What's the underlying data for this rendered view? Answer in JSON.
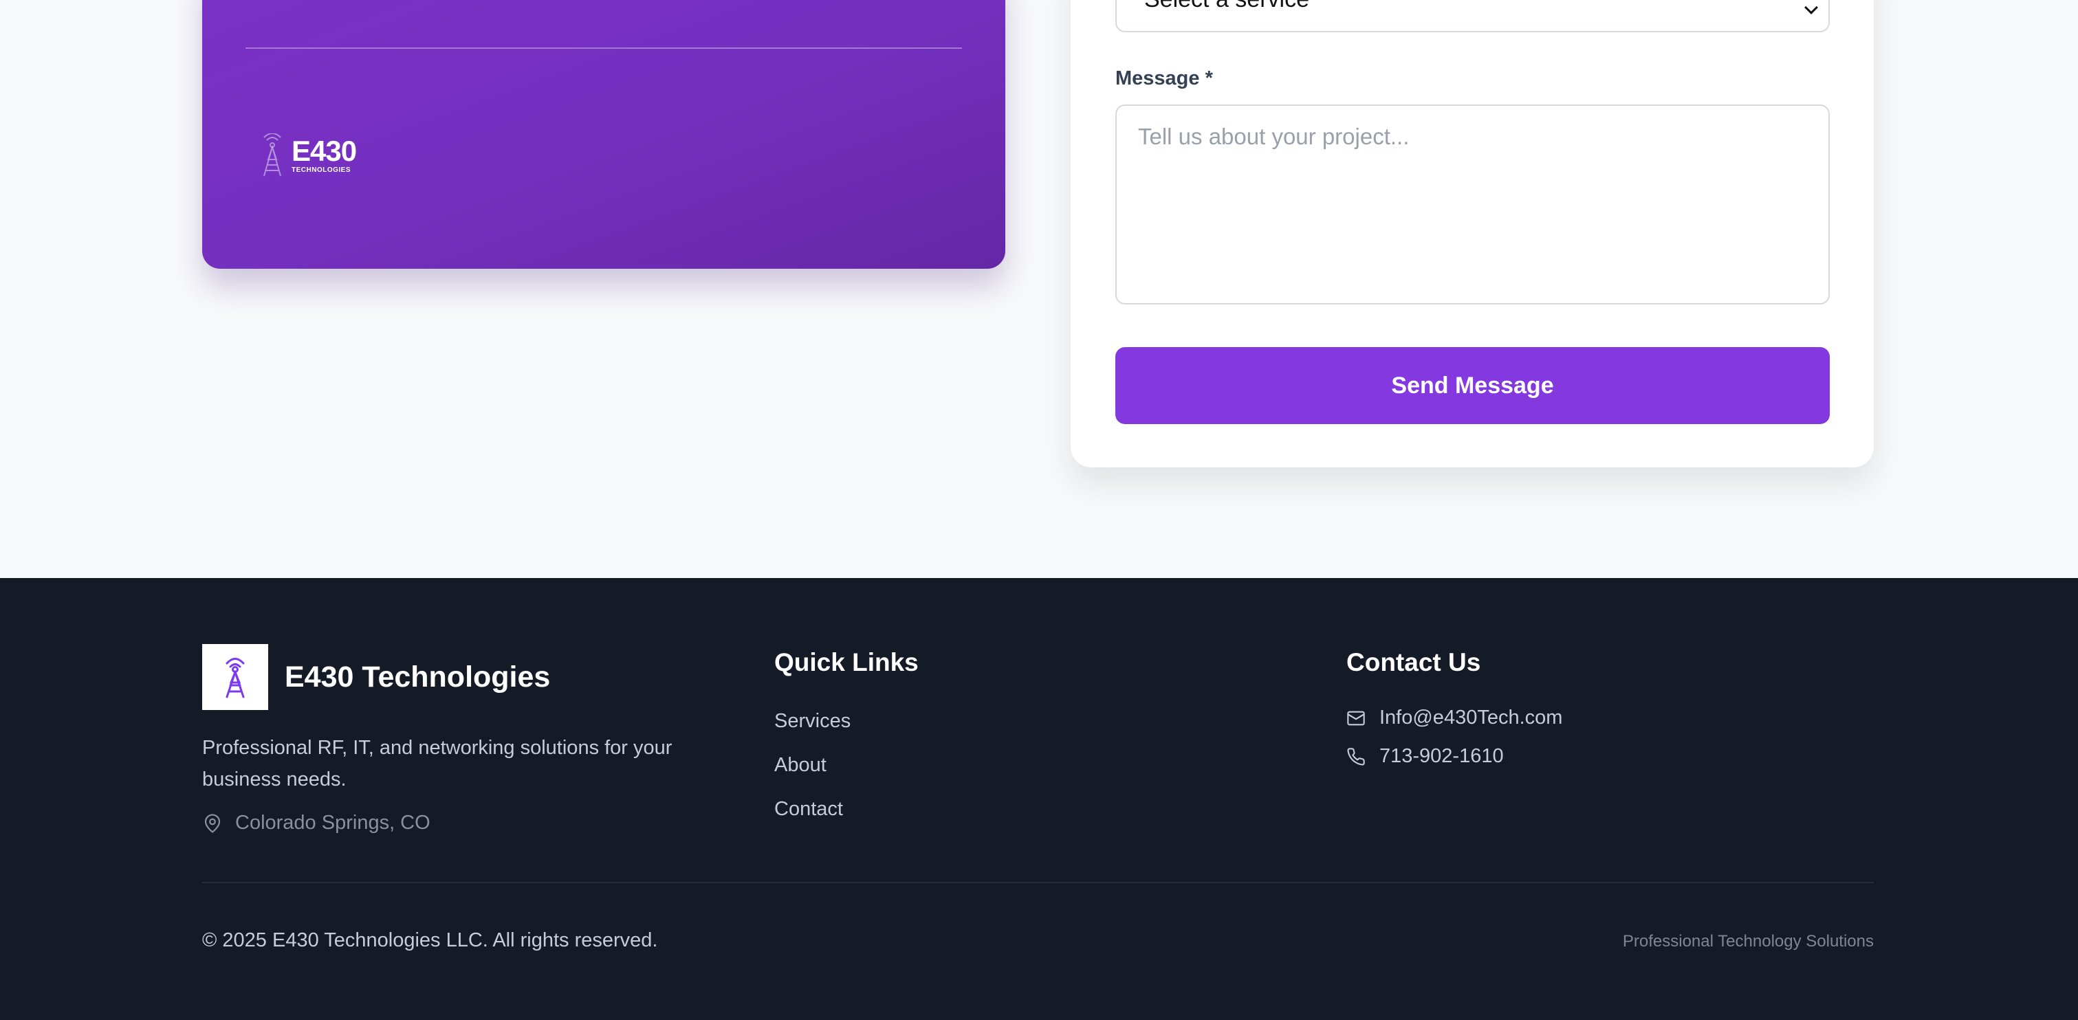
{
  "promo": {
    "logo_name": "E430",
    "logo_sub": "TECHNOLOGIES"
  },
  "form": {
    "service_select_value": "Select a service",
    "message_label": "Message *",
    "message_placeholder": "Tell us about your project...",
    "send_button": "Send Message"
  },
  "footer": {
    "brand_name": "E430 Technologies",
    "brand_description": "Professional RF, IT, and networking solutions for your business needs.",
    "location": "Colorado Springs, CO",
    "quick_links": {
      "title": "Quick Links",
      "items": [
        "Services",
        "About",
        "Contact"
      ]
    },
    "contact": {
      "title": "Contact Us",
      "email": "Info@e430Tech.com",
      "phone": "713-902-1610"
    },
    "copyright": "© 2025 E430 Technologies LLC. All rights reserved.",
    "tagline": "Professional Technology Solutions"
  },
  "colors": {
    "brand_purple": "#8438df",
    "footer_bg": "#151a27",
    "page_bg": "#f8f9fb"
  }
}
